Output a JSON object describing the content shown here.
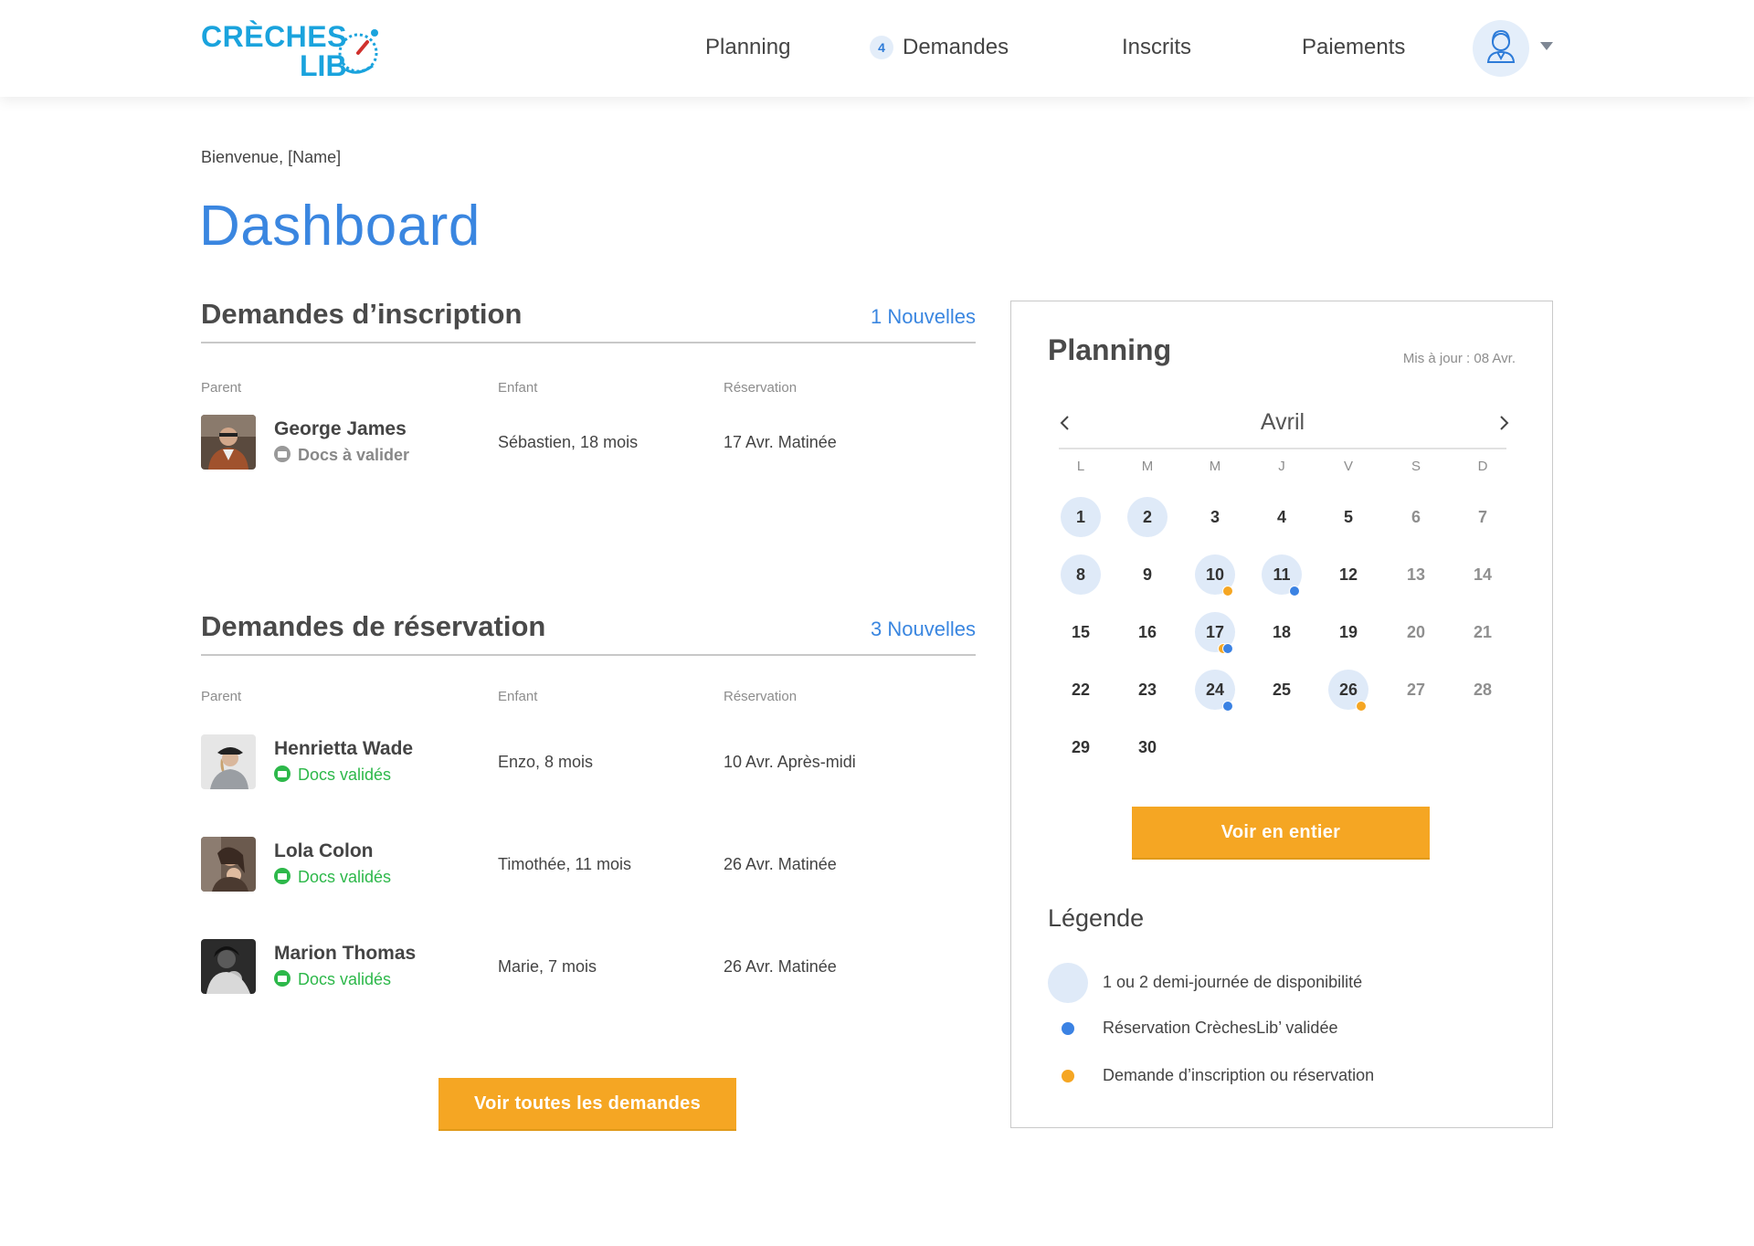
{
  "header": {
    "logo_line1": "CRÈCHES",
    "logo_line2": "LIB",
    "nav": [
      {
        "label": "Planning"
      },
      {
        "label": "Demandes",
        "badge": "4"
      },
      {
        "label": "Inscrits"
      },
      {
        "label": "Paiements"
      }
    ],
    "avatar_icon": "user-avatar-icon",
    "avatar_menu_icon": "caret-down-icon"
  },
  "page": {
    "welcome": "Bienvenue, [Name]",
    "title": "Dashboard"
  },
  "inscriptions": {
    "title": "Demandes d’inscription",
    "link": "1 Nouvelles",
    "columns": [
      "Parent",
      "Enfant",
      "Réservation"
    ],
    "rows": [
      {
        "parent": "George James",
        "status": "Docs à valider",
        "child": "Sébastien, 18 mois",
        "reservation": "17 Avr. Matinée"
      }
    ]
  },
  "reservations": {
    "title": "Demandes de réservation",
    "link": "3 Nouvelles",
    "columns": [
      "Parent",
      "Enfant",
      "Réservation"
    ],
    "rows": [
      {
        "parent": "Henrietta Wade",
        "status": "Docs validés",
        "child": "Enzo, 8 mois",
        "reservation": "10 Avr. Après-midi"
      },
      {
        "parent": "Lola Colon",
        "status": "Docs validés",
        "child": "Timothée, 11 mois",
        "reservation": "26 Avr. Matinée"
      },
      {
        "parent": "Marion Thomas",
        "status": "Docs validés",
        "child": "Marie, 7 mois",
        "reservation": "26 Avr. Matinée"
      }
    ],
    "button": "Voir toutes les demandes"
  },
  "planning": {
    "title": "Planning",
    "updated": "Mis à jour : 08 Avr.",
    "month": "Avril",
    "weekdays": [
      "L",
      "M",
      "M",
      "J",
      "V",
      "S",
      "D"
    ],
    "days": [
      {
        "n": "1",
        "avail": true
      },
      {
        "n": "2",
        "avail": true
      },
      {
        "n": "3"
      },
      {
        "n": "4"
      },
      {
        "n": "5"
      },
      {
        "n": "6"
      },
      {
        "n": "7"
      },
      {
        "n": "8",
        "avail": true
      },
      {
        "n": "9"
      },
      {
        "n": "10",
        "avail": true,
        "dots": [
          "orange"
        ]
      },
      {
        "n": "11",
        "avail": true,
        "dots": [
          "blue"
        ]
      },
      {
        "n": "12"
      },
      {
        "n": "13"
      },
      {
        "n": "14"
      },
      {
        "n": "15"
      },
      {
        "n": "16"
      },
      {
        "n": "17",
        "avail": true,
        "dots": [
          "orange",
          "blue"
        ]
      },
      {
        "n": "18"
      },
      {
        "n": "19"
      },
      {
        "n": "20"
      },
      {
        "n": "21"
      },
      {
        "n": "22"
      },
      {
        "n": "23"
      },
      {
        "n": "24",
        "avail": true,
        "dots": [
          "blue"
        ]
      },
      {
        "n": "25"
      },
      {
        "n": "26",
        "avail": true,
        "dots": [
          "orange"
        ]
      },
      {
        "n": "27"
      },
      {
        "n": "28"
      },
      {
        "n": "29"
      },
      {
        "n": "30"
      }
    ],
    "button": "Voir en entier",
    "legend_title": "Légende",
    "legend": [
      {
        "label": "1 ou 2 demi-journée de disponibilité"
      },
      {
        "label": "Réservation CrèchesLib’ validée",
        "color": "#3b82e3"
      },
      {
        "label": "Demande d’inscription ou réservation",
        "color": "#f5a623"
      }
    ]
  },
  "colors": {
    "accent": "#3a86e0",
    "orange": "#f5a623",
    "green": "#2db84a",
    "available": "#dfeaf8"
  }
}
